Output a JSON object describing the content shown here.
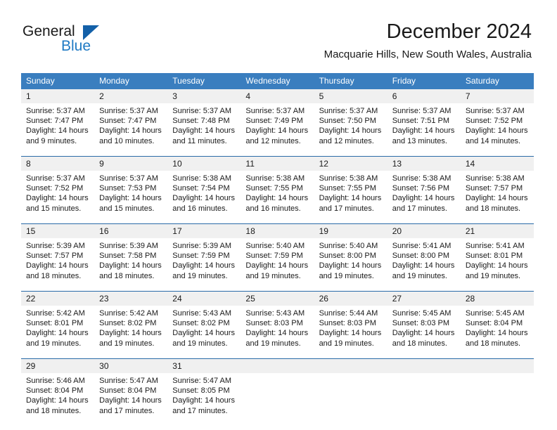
{
  "brand": {
    "name_part1": "General",
    "name_part2": "Blue",
    "triangle_icon": "triangle-icon",
    "accent_color": "#1360a8"
  },
  "header": {
    "month_title": "December 2024",
    "location": "Macquarie Hills, New South Wales, Australia"
  },
  "calendar": {
    "header_bg": "#3a7ebf",
    "row_divider_color": "#2a6ba8",
    "daynum_band_bg": "#f0f0f0",
    "weekday_headers": [
      "Sunday",
      "Monday",
      "Tuesday",
      "Wednesday",
      "Thursday",
      "Friday",
      "Saturday"
    ],
    "weeks": [
      [
        {
          "day": "1",
          "sunrise": "Sunrise: 5:37 AM",
          "sunset": "Sunset: 7:47 PM",
          "daylight_line1": "Daylight: 14 hours",
          "daylight_line2": "and 9 minutes."
        },
        {
          "day": "2",
          "sunrise": "Sunrise: 5:37 AM",
          "sunset": "Sunset: 7:47 PM",
          "daylight_line1": "Daylight: 14 hours",
          "daylight_line2": "and 10 minutes."
        },
        {
          "day": "3",
          "sunrise": "Sunrise: 5:37 AM",
          "sunset": "Sunset: 7:48 PM",
          "daylight_line1": "Daylight: 14 hours",
          "daylight_line2": "and 11 minutes."
        },
        {
          "day": "4",
          "sunrise": "Sunrise: 5:37 AM",
          "sunset": "Sunset: 7:49 PM",
          "daylight_line1": "Daylight: 14 hours",
          "daylight_line2": "and 12 minutes."
        },
        {
          "day": "5",
          "sunrise": "Sunrise: 5:37 AM",
          "sunset": "Sunset: 7:50 PM",
          "daylight_line1": "Daylight: 14 hours",
          "daylight_line2": "and 12 minutes."
        },
        {
          "day": "6",
          "sunrise": "Sunrise: 5:37 AM",
          "sunset": "Sunset: 7:51 PM",
          "daylight_line1": "Daylight: 14 hours",
          "daylight_line2": "and 13 minutes."
        },
        {
          "day": "7",
          "sunrise": "Sunrise: 5:37 AM",
          "sunset": "Sunset: 7:52 PM",
          "daylight_line1": "Daylight: 14 hours",
          "daylight_line2": "and 14 minutes."
        }
      ],
      [
        {
          "day": "8",
          "sunrise": "Sunrise: 5:37 AM",
          "sunset": "Sunset: 7:52 PM",
          "daylight_line1": "Daylight: 14 hours",
          "daylight_line2": "and 15 minutes."
        },
        {
          "day": "9",
          "sunrise": "Sunrise: 5:37 AM",
          "sunset": "Sunset: 7:53 PM",
          "daylight_line1": "Daylight: 14 hours",
          "daylight_line2": "and 15 minutes."
        },
        {
          "day": "10",
          "sunrise": "Sunrise: 5:38 AM",
          "sunset": "Sunset: 7:54 PM",
          "daylight_line1": "Daylight: 14 hours",
          "daylight_line2": "and 16 minutes."
        },
        {
          "day": "11",
          "sunrise": "Sunrise: 5:38 AM",
          "sunset": "Sunset: 7:55 PM",
          "daylight_line1": "Daylight: 14 hours",
          "daylight_line2": "and 16 minutes."
        },
        {
          "day": "12",
          "sunrise": "Sunrise: 5:38 AM",
          "sunset": "Sunset: 7:55 PM",
          "daylight_line1": "Daylight: 14 hours",
          "daylight_line2": "and 17 minutes."
        },
        {
          "day": "13",
          "sunrise": "Sunrise: 5:38 AM",
          "sunset": "Sunset: 7:56 PM",
          "daylight_line1": "Daylight: 14 hours",
          "daylight_line2": "and 17 minutes."
        },
        {
          "day": "14",
          "sunrise": "Sunrise: 5:38 AM",
          "sunset": "Sunset: 7:57 PM",
          "daylight_line1": "Daylight: 14 hours",
          "daylight_line2": "and 18 minutes."
        }
      ],
      [
        {
          "day": "15",
          "sunrise": "Sunrise: 5:39 AM",
          "sunset": "Sunset: 7:57 PM",
          "daylight_line1": "Daylight: 14 hours",
          "daylight_line2": "and 18 minutes."
        },
        {
          "day": "16",
          "sunrise": "Sunrise: 5:39 AM",
          "sunset": "Sunset: 7:58 PM",
          "daylight_line1": "Daylight: 14 hours",
          "daylight_line2": "and 18 minutes."
        },
        {
          "day": "17",
          "sunrise": "Sunrise: 5:39 AM",
          "sunset": "Sunset: 7:59 PM",
          "daylight_line1": "Daylight: 14 hours",
          "daylight_line2": "and 19 minutes."
        },
        {
          "day": "18",
          "sunrise": "Sunrise: 5:40 AM",
          "sunset": "Sunset: 7:59 PM",
          "daylight_line1": "Daylight: 14 hours",
          "daylight_line2": "and 19 minutes."
        },
        {
          "day": "19",
          "sunrise": "Sunrise: 5:40 AM",
          "sunset": "Sunset: 8:00 PM",
          "daylight_line1": "Daylight: 14 hours",
          "daylight_line2": "and 19 minutes."
        },
        {
          "day": "20",
          "sunrise": "Sunrise: 5:41 AM",
          "sunset": "Sunset: 8:00 PM",
          "daylight_line1": "Daylight: 14 hours",
          "daylight_line2": "and 19 minutes."
        },
        {
          "day": "21",
          "sunrise": "Sunrise: 5:41 AM",
          "sunset": "Sunset: 8:01 PM",
          "daylight_line1": "Daylight: 14 hours",
          "daylight_line2": "and 19 minutes."
        }
      ],
      [
        {
          "day": "22",
          "sunrise": "Sunrise: 5:42 AM",
          "sunset": "Sunset: 8:01 PM",
          "daylight_line1": "Daylight: 14 hours",
          "daylight_line2": "and 19 minutes."
        },
        {
          "day": "23",
          "sunrise": "Sunrise: 5:42 AM",
          "sunset": "Sunset: 8:02 PM",
          "daylight_line1": "Daylight: 14 hours",
          "daylight_line2": "and 19 minutes."
        },
        {
          "day": "24",
          "sunrise": "Sunrise: 5:43 AM",
          "sunset": "Sunset: 8:02 PM",
          "daylight_line1": "Daylight: 14 hours",
          "daylight_line2": "and 19 minutes."
        },
        {
          "day": "25",
          "sunrise": "Sunrise: 5:43 AM",
          "sunset": "Sunset: 8:03 PM",
          "daylight_line1": "Daylight: 14 hours",
          "daylight_line2": "and 19 minutes."
        },
        {
          "day": "26",
          "sunrise": "Sunrise: 5:44 AM",
          "sunset": "Sunset: 8:03 PM",
          "daylight_line1": "Daylight: 14 hours",
          "daylight_line2": "and 19 minutes."
        },
        {
          "day": "27",
          "sunrise": "Sunrise: 5:45 AM",
          "sunset": "Sunset: 8:03 PM",
          "daylight_line1": "Daylight: 14 hours",
          "daylight_line2": "and 18 minutes."
        },
        {
          "day": "28",
          "sunrise": "Sunrise: 5:45 AM",
          "sunset": "Sunset: 8:04 PM",
          "daylight_line1": "Daylight: 14 hours",
          "daylight_line2": "and 18 minutes."
        }
      ],
      [
        {
          "day": "29",
          "sunrise": "Sunrise: 5:46 AM",
          "sunset": "Sunset: 8:04 PM",
          "daylight_line1": "Daylight: 14 hours",
          "daylight_line2": "and 18 minutes."
        },
        {
          "day": "30",
          "sunrise": "Sunrise: 5:47 AM",
          "sunset": "Sunset: 8:04 PM",
          "daylight_line1": "Daylight: 14 hours",
          "daylight_line2": "and 17 minutes."
        },
        {
          "day": "31",
          "sunrise": "Sunrise: 5:47 AM",
          "sunset": "Sunset: 8:05 PM",
          "daylight_line1": "Daylight: 14 hours",
          "daylight_line2": "and 17 minutes."
        },
        {
          "day": "",
          "sunrise": "",
          "sunset": "",
          "daylight_line1": "",
          "daylight_line2": ""
        },
        {
          "day": "",
          "sunrise": "",
          "sunset": "",
          "daylight_line1": "",
          "daylight_line2": ""
        },
        {
          "day": "",
          "sunrise": "",
          "sunset": "",
          "daylight_line1": "",
          "daylight_line2": ""
        },
        {
          "day": "",
          "sunrise": "",
          "sunset": "",
          "daylight_line1": "",
          "daylight_line2": ""
        }
      ]
    ]
  }
}
